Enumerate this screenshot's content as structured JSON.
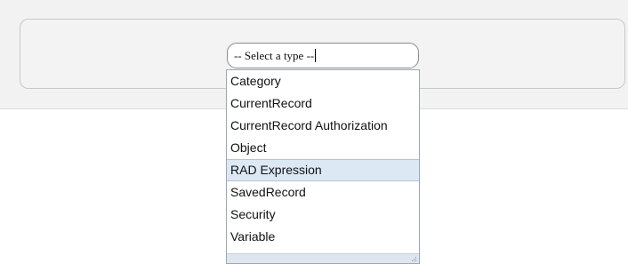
{
  "type_select": {
    "value": "-- Select a type --"
  },
  "dropdown": {
    "options": [
      {
        "label": "Category"
      },
      {
        "label": "CurrentRecord"
      },
      {
        "label": "CurrentRecord Authorization"
      },
      {
        "label": "Object"
      },
      {
        "label": "RAD Expression",
        "highlighted": true
      },
      {
        "label": "SavedRecord"
      },
      {
        "label": "Security"
      },
      {
        "label": "Variable"
      }
    ],
    "resize_icon": "resize-grip-icon"
  }
}
